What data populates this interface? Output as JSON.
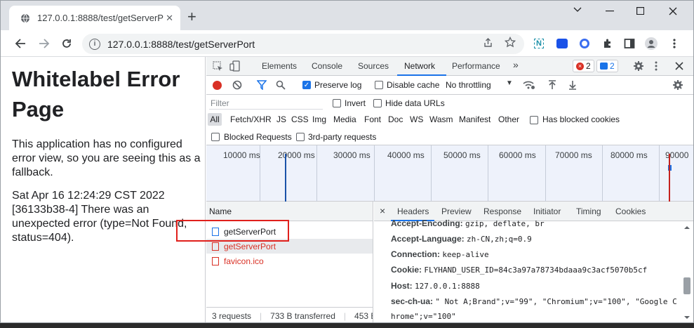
{
  "browser": {
    "tab_title": "127.0.0.1:8888/test/getServerP",
    "new_tab_symbol": "+",
    "url": "127.0.0.1:8888/test/getServerPort",
    "extension_n": "N"
  },
  "page": {
    "heading": "Whitelabel Error Page",
    "para1": "This application has no configured error view, so you are seeing this as a fallback.",
    "para2": "Sat Apr 16 12:24:29 CST 2022 [36133b38-4] There was an unexpected error (type=Not Found, status=404)."
  },
  "devtools": {
    "tabs": [
      "Elements",
      "Console",
      "Sources",
      "Network",
      "Performance"
    ],
    "active_tab": "Network",
    "more_tabs": "»",
    "error_count": "2",
    "message_count": "2",
    "preserve_log": "Preserve log",
    "disable_cache": "Disable cache",
    "throttling": "No throttling",
    "filter_placeholder": "Filter",
    "invert": "Invert",
    "hide_data_urls": "Hide data URLs",
    "types": [
      "All",
      "Fetch/XHR",
      "JS",
      "CSS",
      "Img",
      "Media",
      "Font",
      "Doc",
      "WS",
      "Wasm",
      "Manifest",
      "Other"
    ],
    "has_blocked_cookies": "Has blocked cookies",
    "blocked_requests": "Blocked Requests",
    "third_party": "3rd-party requests",
    "timeline_ticks": [
      "10000 ms",
      "20000 ms",
      "30000 ms",
      "40000 ms",
      "50000 ms",
      "60000 ms",
      "70000 ms",
      "80000 ms",
      "90000"
    ],
    "name_header": "Name",
    "requests": [
      {
        "name": "getServerPort",
        "error": false
      },
      {
        "name": "getServerPort",
        "error": true
      },
      {
        "name": "favicon.ico",
        "error": true
      }
    ],
    "status": {
      "requests": "3 requests",
      "transferred": "733 B transferred",
      "resources": "453 B re"
    },
    "detail_close": "×",
    "detail_tabs": [
      "Headers",
      "Preview",
      "Response",
      "Initiator",
      "Timing",
      "Cookies"
    ],
    "headers": [
      {
        "name": "Accept-Encoding:",
        "value": "gzip, deflate, br"
      },
      {
        "name": "Accept-Language:",
        "value": "zh-CN,zh;q=0.9"
      },
      {
        "name": "Connection:",
        "value": "keep-alive"
      },
      {
        "name": "Cookie:",
        "value": "FLYHAND_USER_ID=84c3a97a78734bdaaa9c3acf5070b5cf"
      },
      {
        "name": "Host:",
        "value": "127.0.0.1:8888"
      },
      {
        "name": "sec-ch-ua:",
        "value": "\" Not A;Brand\";v=\"99\", \"Chromium\";v=\"100\", \"Google C"
      },
      {
        "name": "",
        "value": "hrome\";v=\"100\""
      }
    ]
  },
  "colors": {
    "accent": "#1a73e8",
    "error": "#d93025",
    "highlight_box": "#e0201c"
  }
}
